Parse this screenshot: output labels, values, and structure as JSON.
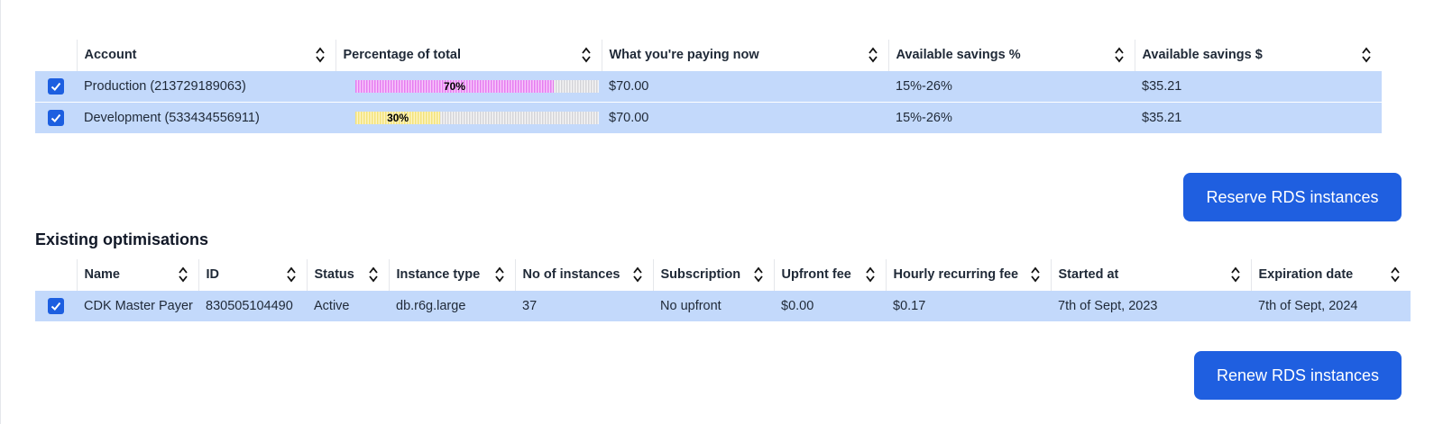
{
  "accounts_table": {
    "columns": [
      "Account",
      "Percentage of total",
      "What you're paying now",
      "Available savings %",
      "Available savings $"
    ],
    "rows": [
      {
        "account": "Production (213729189063)",
        "percent_label": "70%",
        "percent": 70,
        "bar_color": "#e67cf0",
        "paying_now": "$70.00",
        "savings_pct": "15%-26%",
        "savings_usd": "$35.21",
        "checked": true
      },
      {
        "account": "Development (533434556911)",
        "percent_label": "30%",
        "percent": 30,
        "bar_color": "#f3e27b",
        "paying_now": "$70.00",
        "savings_pct": "15%-26%",
        "savings_usd": "$35.21",
        "checked": true
      }
    ]
  },
  "reserve_button": {
    "label": "Reserve RDS instances"
  },
  "existing": {
    "title": "Existing optimisations",
    "columns": [
      "Name",
      "ID",
      "Status",
      "Instance type",
      "No of instances",
      "Subscription",
      "Upfront fee",
      "Hourly recurring fee",
      "Started at",
      "Expiration date"
    ],
    "rows": [
      {
        "name": "CDK Master Payer",
        "id": "830505104490",
        "status": "Active",
        "instance_type": "db.r6g.large",
        "instances": "37",
        "subscription": "No upfront",
        "upfront_fee": "$0.00",
        "hourly_fee": "$0.17",
        "started_at": "7th of Sept, 2023",
        "expiration": "7th of Sept, 2024",
        "checked": true
      }
    ]
  },
  "renew_button": {
    "label": "Renew RDS instances"
  },
  "colors": {
    "accent": "#1f5fe0",
    "row_selected": "#c3d9fb"
  }
}
